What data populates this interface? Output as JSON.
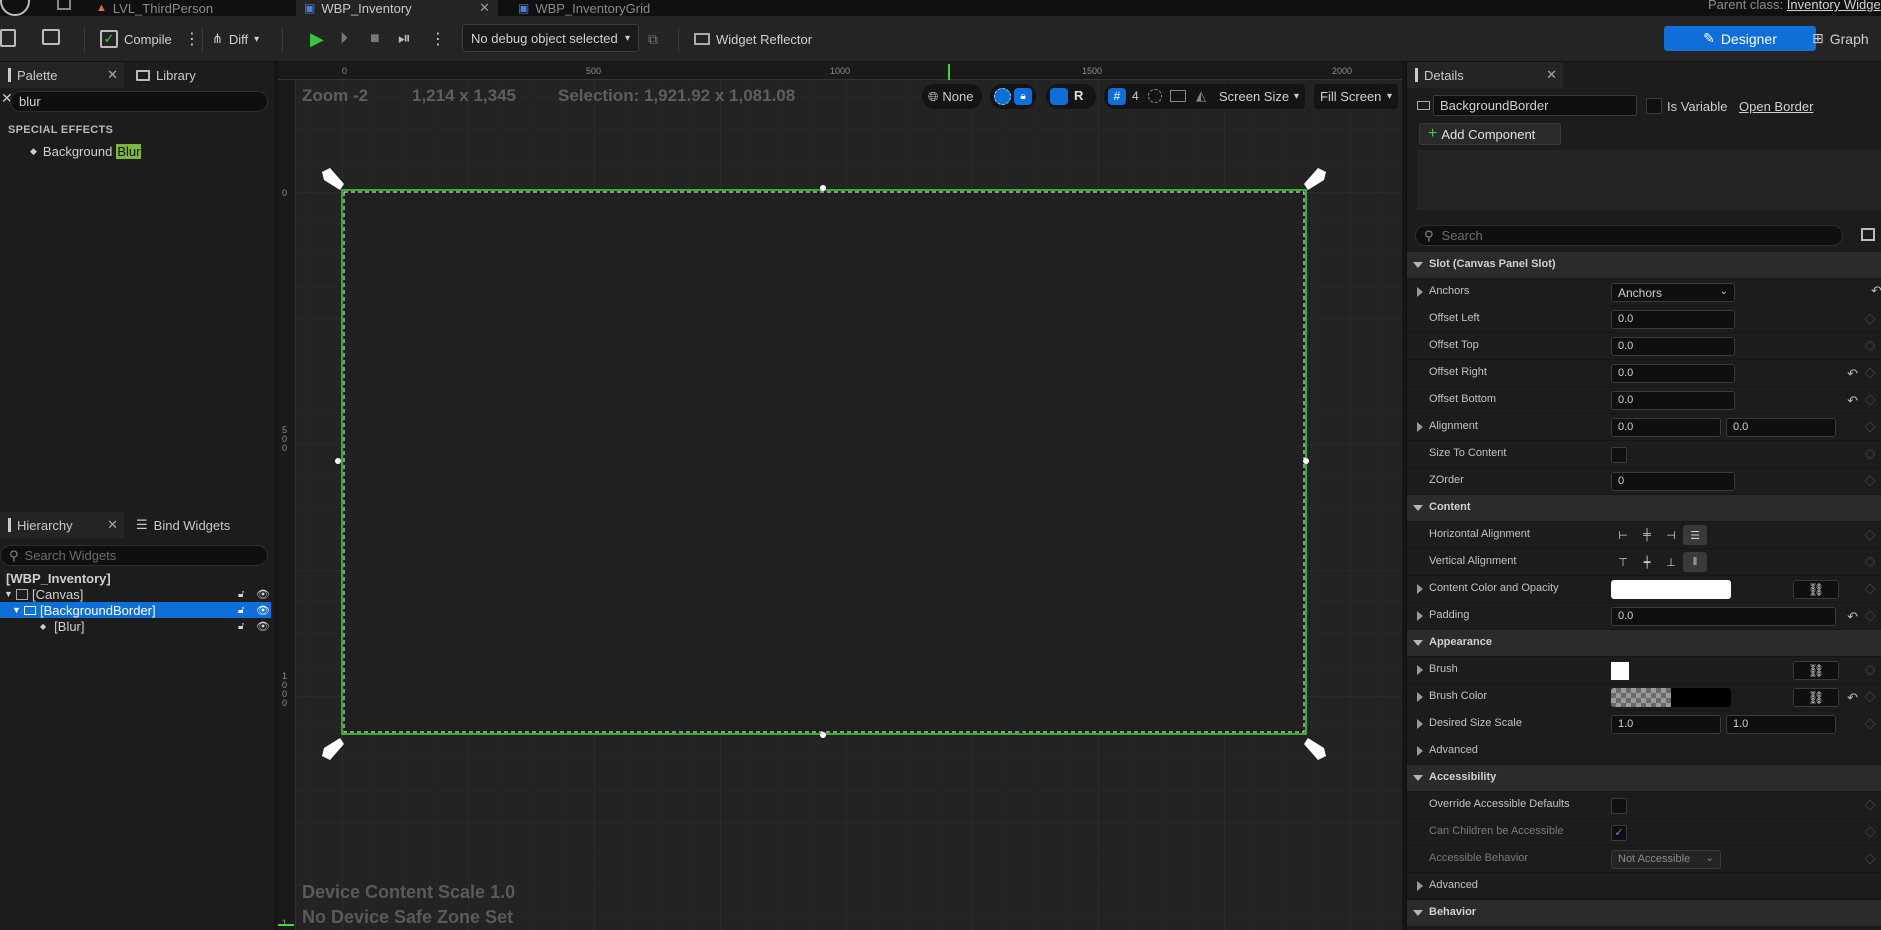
{
  "asset_tabs": [
    {
      "label": "LVL_ThirdPerson"
    },
    {
      "label": "WBP_Inventory"
    },
    {
      "label": "WBP_InventoryGrid"
    }
  ],
  "parent_class": {
    "label": "Parent class:",
    "value": "Inventory Widge"
  },
  "toolbar": {
    "compile_label": "Compile",
    "diff_label": "Diff",
    "debug_object": "No debug object selected",
    "widget_reflector_label": "Widget Reflector",
    "designer_label": "Designer",
    "graph_label": "Graph"
  },
  "palette": {
    "tab_label": "Palette",
    "library_label": "Library",
    "search_value": "blur",
    "section": "SPECIAL EFFECTS",
    "item_prefix": "Background",
    "item_match": "Blur"
  },
  "hierarchy": {
    "tab_label": "Hierarchy",
    "bind_widgets_label": "Bind Widgets",
    "search_placeholder": "Search Widgets",
    "root": "[WBP_Inventory]",
    "canvas": "[Canvas]",
    "border": "[BackgroundBorder]",
    "blur": "[Blur]"
  },
  "viewport": {
    "zoom": "Zoom -2",
    "resolution": "1,214 x 1,345",
    "selection": "Selection: 1,921.92 x 1,081.08",
    "ruler_top": [
      "0",
      "500",
      "1000",
      "1500",
      "2000"
    ],
    "ruler_left": [
      "0",
      "5\n0\n0",
      "1\n0\n0\n0",
      "1"
    ],
    "none_label": "None",
    "r_label": "R",
    "grid_size": "4",
    "screen_size_label": "Screen Size",
    "fill_screen_label": "Fill Screen",
    "device_scale": "Device Content Scale 1.0",
    "safe_zone": "No Device Safe Zone Set"
  },
  "details": {
    "tab_label": "Details",
    "widget_name": "BackgroundBorder",
    "is_variable_label": "Is Variable",
    "open_link": "Open Border",
    "add_component_label": "Add Component",
    "search_placeholder": "Search",
    "slot_section": "Slot (Canvas Panel Slot)",
    "anchors_label": "Anchors",
    "anchors_value": "Anchors",
    "offset_left_label": "Offset Left",
    "offset_left": "0.0",
    "offset_top_label": "Offset Top",
    "offset_top": "0.0",
    "offset_right_label": "Offset Right",
    "offset_right": "0.0",
    "offset_bottom_label": "Offset Bottom",
    "offset_bottom": "0.0",
    "alignment_label": "Alignment",
    "alignment_x": "0.0",
    "alignment_y": "0.0",
    "size_to_content_label": "Size To Content",
    "zorder_label": "ZOrder",
    "zorder": "0",
    "content_section": "Content",
    "h_align_label": "Horizontal Alignment",
    "v_align_label": "Vertical Alignment",
    "content_color_label": "Content Color and Opacity",
    "padding_label": "Padding",
    "padding": "0.0",
    "appearance_section": "Appearance",
    "brush_label": "Brush",
    "brush_color_label": "Brush Color",
    "desired_size_label": "Desired Size Scale",
    "desired_x": "1.0",
    "desired_y": "1.0",
    "advanced_label": "Advanced",
    "accessibility_section": "Accessibility",
    "override_label": "Override Accessible Defaults",
    "children_label": "Can Children be Accessible",
    "behavior_label": "Accessible Behavior",
    "behavior_value": "Not Accessible",
    "advanced2_label": "Advanced",
    "behavior_section": "Behavior"
  },
  "colors": {
    "accent_blue": "#0e6fd8",
    "selection_green": "#3ddc2e",
    "search_highlight": "#7db73a"
  }
}
